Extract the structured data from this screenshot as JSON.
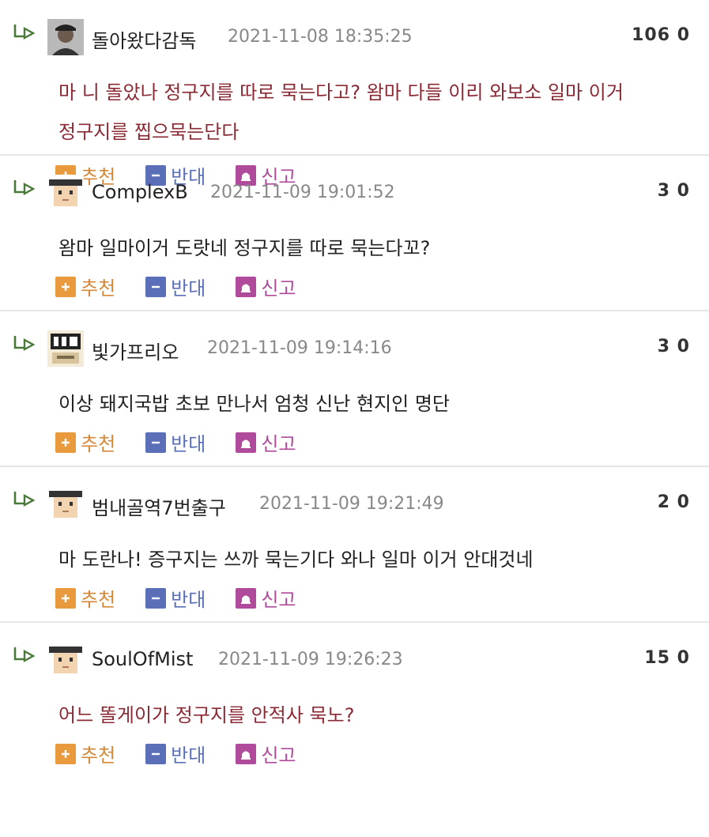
{
  "colors": {
    "recommend": "#e89a3c",
    "oppose": "#5a6fb7",
    "report": "#b04a9a",
    "highlight_text": "#8a2a35"
  },
  "actions": {
    "recommend_label": "추천",
    "oppose_label": "반대",
    "report_label": "신고"
  },
  "comments": [
    {
      "nickname": "돌아왔다감독",
      "datetime": "2021-11-08 18:35:25",
      "score": "106 0",
      "text_line1": "마 니 돌았나 정구지를 따로 묵는다고? 왐마 다들 이리 와보소 일마 이거",
      "text_line2": "정구지를 찝으묵는단다",
      "avatar_icon": "profile-photo-icon"
    },
    {
      "nickname": "ComplexB",
      "datetime": "2021-11-09 19:01:52",
      "score": "3 0",
      "text_line1": "왐마 일마이거 도랏네 정구지를 따로 묵는다꼬?",
      "avatar_icon": "pixel-face-icon"
    },
    {
      "nickname": "빛가프리오",
      "datetime": "2021-11-09 19:14:16",
      "score": "3 0",
      "text_line1": "이상 돼지국밥 초보 만나서 엄청 신난 현지인 명단",
      "avatar_icon": "custom-badge-icon"
    },
    {
      "nickname": "범내골역7번출구",
      "datetime": "2021-11-09 19:21:49",
      "score": "2 0",
      "text_line1": "마 도란나! 증구지는 쓰까 묵는기다 와나 일마 이거 안대것네",
      "avatar_icon": "pixel-face-icon"
    },
    {
      "nickname": "SoulOfMist",
      "datetime": "2021-11-09 19:26:23",
      "score": "15 0",
      "text_line1": "어느 똘게이가 정구지를 안적사 묵노?",
      "avatar_icon": "pixel-face-icon"
    }
  ]
}
